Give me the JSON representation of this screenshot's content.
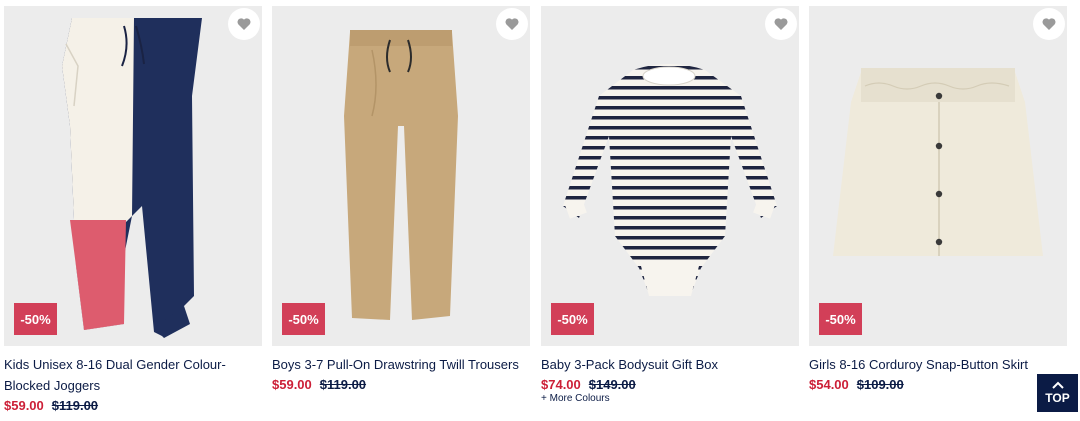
{
  "products": [
    {
      "title": "Kids Unisex 8-16 Dual Gender Colour-Blocked Joggers",
      "badge": "-50%",
      "price": "$59.00",
      "original_price": "$119.00",
      "more": ""
    },
    {
      "title": "Boys 3-7 Pull-On Drawstring Twill Trousers",
      "badge": "-50%",
      "price": "$59.00",
      "original_price": "$119.00",
      "more": ""
    },
    {
      "title": "Baby 3-Pack Bodysuit Gift Box",
      "badge": "-50%",
      "price": "$74.00",
      "original_price": "$149.00",
      "more": "+ More Colours"
    },
    {
      "title": "Girls 8-16 Corduroy Snap-Button Skirt",
      "badge": "-50%",
      "price": "$54.00",
      "original_price": "$109.00",
      "more": ""
    }
  ],
  "top_button": {
    "label": "TOP"
  },
  "colors": {
    "sale_red": "#cc1f37",
    "badge_red": "#d23f58",
    "navy": "#0b1b45",
    "image_bg": "#ececec"
  },
  "icons": {
    "favourite": "heart-icon",
    "scroll_top": "chevron-up-icon"
  }
}
